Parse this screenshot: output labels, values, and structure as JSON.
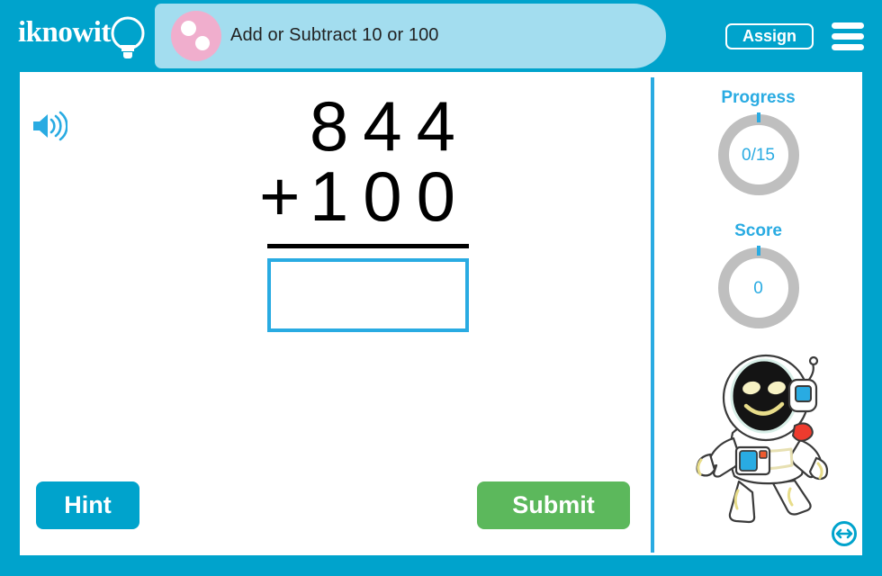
{
  "header": {
    "logo_text": "iknowit",
    "logo_icon": "lightbulb-icon",
    "activity_icon": "pink-circle-dots-icon",
    "title": "Add or Subtract 10 or 100",
    "assign_label": "Assign",
    "menu_icon": "hamburger-menu-icon",
    "bg_color": "#00a3cc",
    "pill_color": "#a3ddef",
    "dot_color": "#f0aecd"
  },
  "workspace": {
    "audio_icon": "speaker-icon",
    "problem": {
      "top_number": "844",
      "operator": "+",
      "bottom_number": "100",
      "answer_value": "",
      "answer_placeholder": ""
    },
    "hint_label": "Hint",
    "submit_label": "Submit",
    "hint_color": "#00a3cc",
    "submit_color": "#5cb85c",
    "accent_color": "#29abe2"
  },
  "sidebar": {
    "progress": {
      "label": "Progress",
      "value": "0/15",
      "completed": 0,
      "total": 15,
      "ring_color": "#bfbfbf",
      "tick_color": "#29abe2"
    },
    "score": {
      "label": "Score",
      "value": "0",
      "ring_color": "#bfbfbf",
      "tick_color": "#29abe2"
    },
    "mascot": "astronaut-mascot",
    "resize_icon": "resize-horizontal-icon"
  }
}
